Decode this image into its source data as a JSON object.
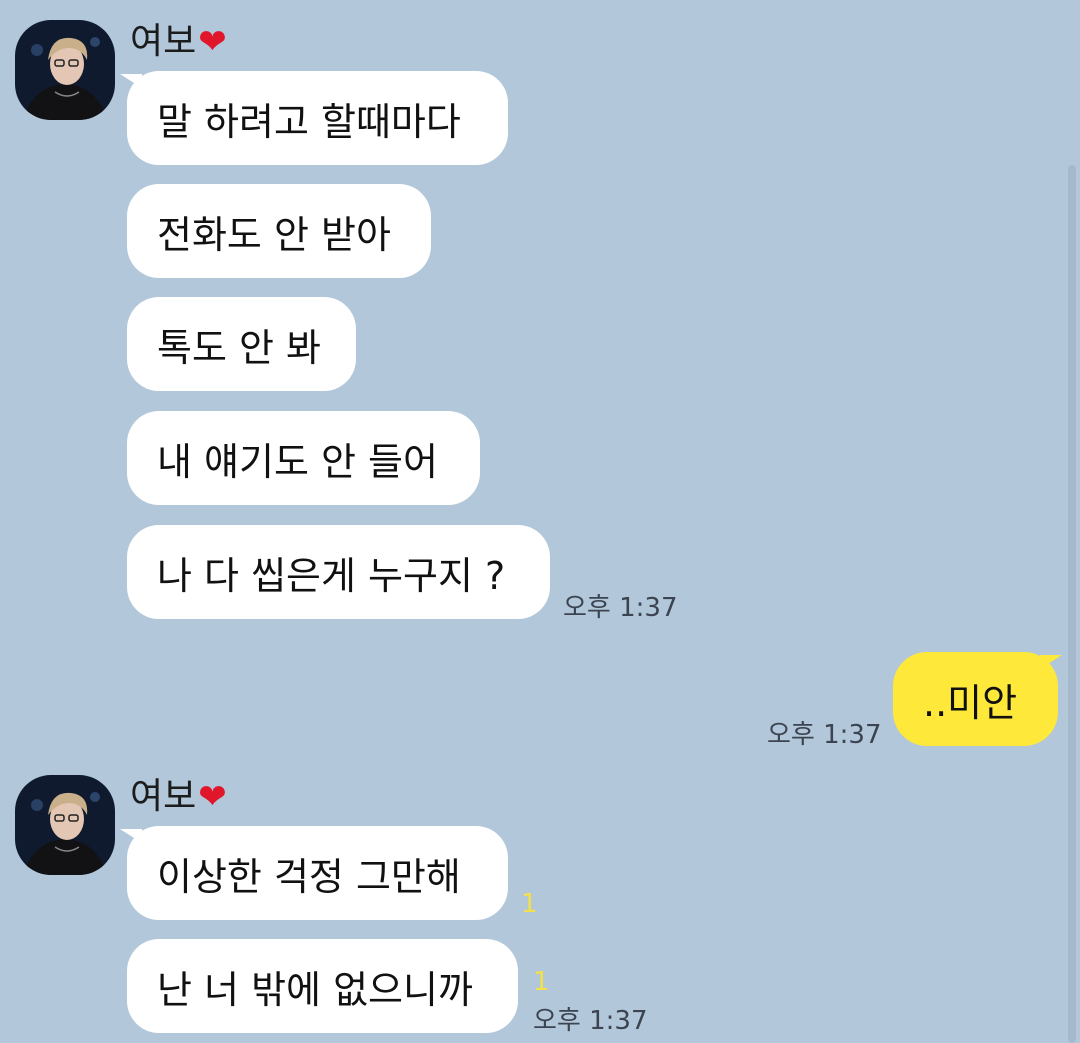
{
  "conversation": {
    "groups": [
      {
        "sender": {
          "name": "여보",
          "heart": "❤",
          "avatar_icon": "profile-photo-icon"
        },
        "messages": [
          {
            "text": "말 하려고 할때마다"
          },
          {
            "text": "전화도 안 받아"
          },
          {
            "text": "톡도 안 봐"
          },
          {
            "text": "내 얘기도 안 들어"
          },
          {
            "text": "나 다 씹은게 누구지 ?",
            "time": "오후 1:37"
          }
        ]
      },
      {
        "mine": true,
        "messages": [
          {
            "text": "..미안",
            "time": "오후 1:37"
          }
        ]
      },
      {
        "sender": {
          "name": "여보",
          "heart": "❤",
          "avatar_icon": "profile-photo-icon"
        },
        "messages": [
          {
            "text": "이상한 걱정 그만해",
            "unread": "1"
          },
          {
            "text": "난 너 밖에 없으니까",
            "unread": "1",
            "time": "오후 1:37"
          }
        ]
      }
    ]
  },
  "colors": {
    "background": "#b2c7da",
    "incoming_bubble": "#ffffff",
    "outgoing_bubble": "#fee93a",
    "unread_count": "#f4e04a",
    "heart": "#e0162b"
  }
}
